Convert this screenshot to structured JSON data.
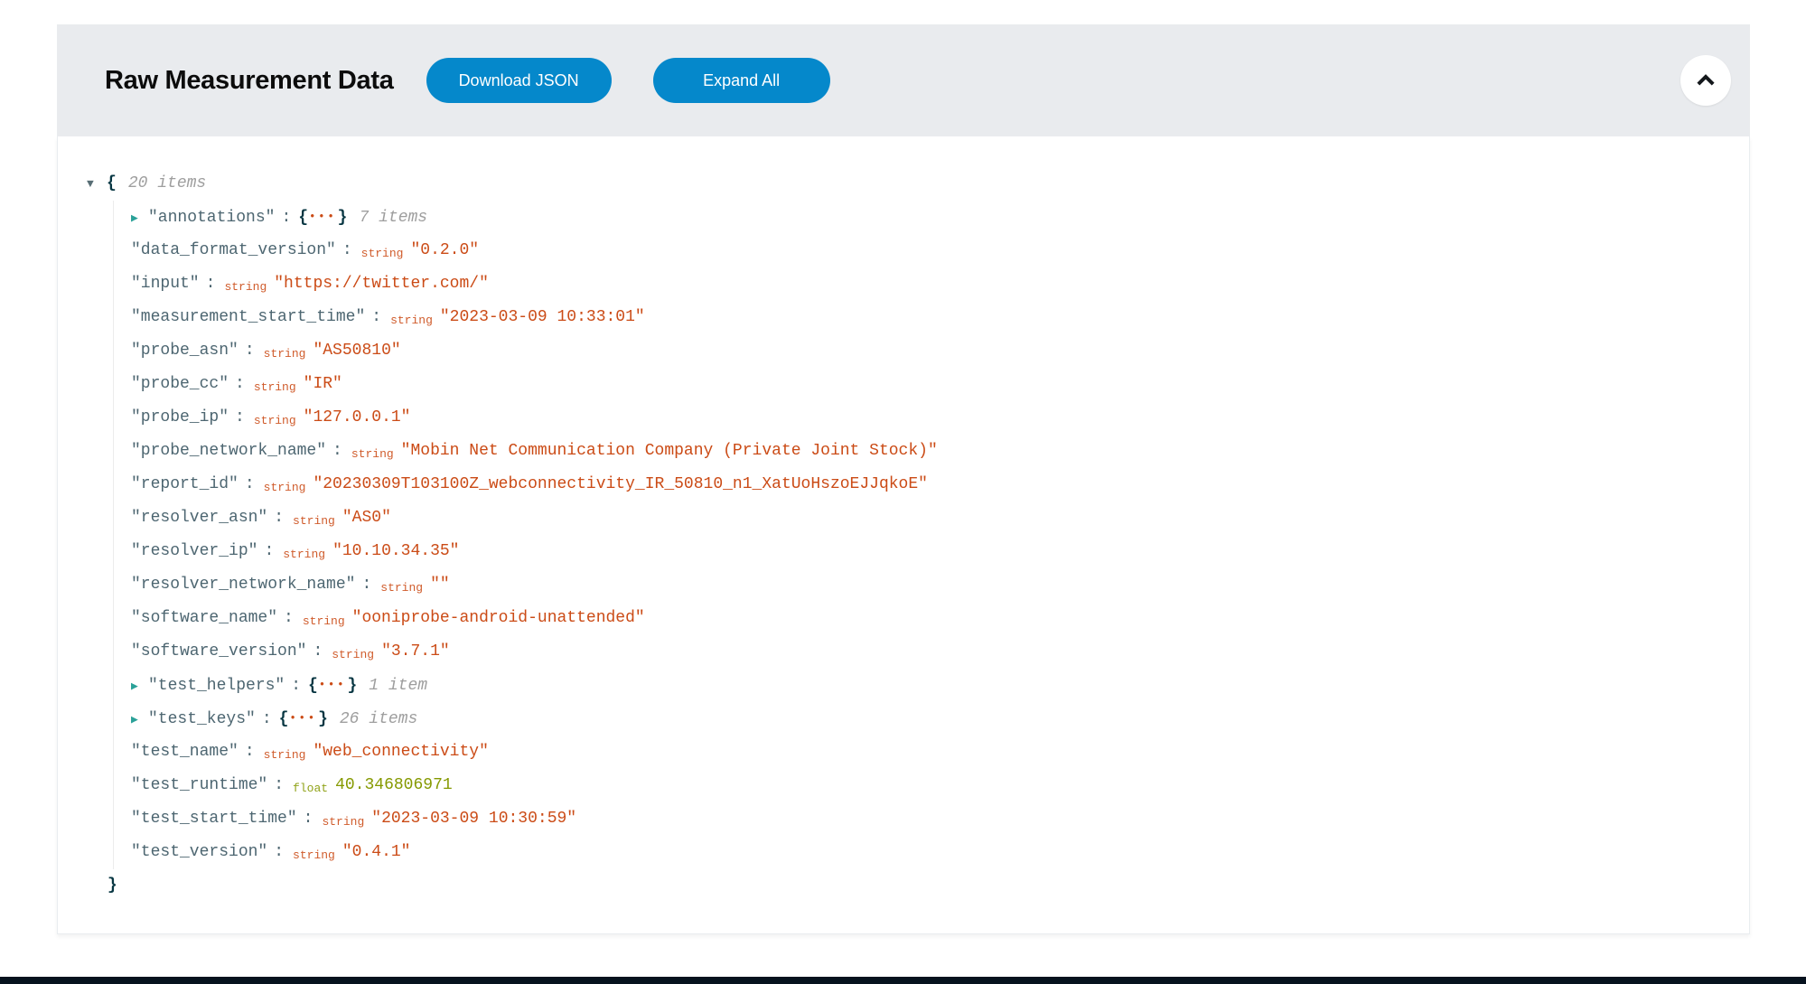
{
  "header": {
    "title": "Raw Measurement Data",
    "download_button": "Download JSON",
    "expand_button": "Expand All",
    "collapse_icon": "chevron-up"
  },
  "colors": {
    "accent": "#0588cb",
    "header_bg": "#e9ebee",
    "title_color": "#0c0c0c",
    "button_text": "#ffffff",
    "key_color": "#4d6671",
    "string_color": "#cb4b16",
    "float_color": "#859900",
    "meta_color": "#9e9e9e",
    "arrow_collapsed": "#2aa198",
    "arrow_expanded": "#586e75",
    "brace_color": "#073642",
    "guide_line": "#ececec",
    "panel_border": "#e9edf0",
    "footer_bar": "#06121e"
  },
  "json_tree": {
    "root_meta": "20 items",
    "syntax": {
      "open_brace": "{",
      "close_brace": "}",
      "quote": "\"",
      "colon": ":",
      "ellipsis": "•••",
      "expanded_arrow": "▼",
      "collapsed_arrow": "▶"
    },
    "type_labels": {
      "string": "string",
      "float": "float"
    },
    "entries": [
      {
        "key": "annotations",
        "kind": "object",
        "meta": "7 items"
      },
      {
        "key": "data_format_version",
        "kind": "string",
        "value": "0.2.0"
      },
      {
        "key": "input",
        "kind": "string",
        "value": "https://twitter.com/"
      },
      {
        "key": "measurement_start_time",
        "kind": "string",
        "value": "2023-03-09 10:33:01"
      },
      {
        "key": "probe_asn",
        "kind": "string",
        "value": "AS50810"
      },
      {
        "key": "probe_cc",
        "kind": "string",
        "value": "IR"
      },
      {
        "key": "probe_ip",
        "kind": "string",
        "value": "127.0.0.1"
      },
      {
        "key": "probe_network_name",
        "kind": "string",
        "value": "Mobin Net Communication Company (Private Joint Stock)"
      },
      {
        "key": "report_id",
        "kind": "string",
        "value": "20230309T103100Z_webconnectivity_IR_50810_n1_XatUoHszoEJJqkoE"
      },
      {
        "key": "resolver_asn",
        "kind": "string",
        "value": "AS0"
      },
      {
        "key": "resolver_ip",
        "kind": "string",
        "value": "10.10.34.35"
      },
      {
        "key": "resolver_network_name",
        "kind": "string",
        "value": ""
      },
      {
        "key": "software_name",
        "kind": "string",
        "value": "ooniprobe-android-unattended"
      },
      {
        "key": "software_version",
        "kind": "string",
        "value": "3.7.1"
      },
      {
        "key": "test_helpers",
        "kind": "object",
        "meta": "1 item"
      },
      {
        "key": "test_keys",
        "kind": "object",
        "meta": "26 items"
      },
      {
        "key": "test_name",
        "kind": "string",
        "value": "web_connectivity"
      },
      {
        "key": "test_runtime",
        "kind": "float",
        "value": "40.346806971"
      },
      {
        "key": "test_start_time",
        "kind": "string",
        "value": "2023-03-09 10:30:59"
      },
      {
        "key": "test_version",
        "kind": "string",
        "value": "0.4.1"
      }
    ]
  }
}
